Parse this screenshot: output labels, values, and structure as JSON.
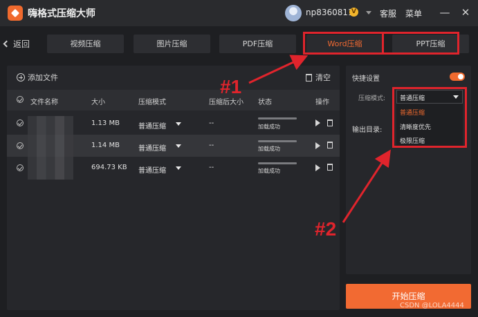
{
  "titlebar": {
    "app_title": "嗨格式压缩大师",
    "username": "np8360811",
    "vip_badge": "V",
    "support_label": "客服",
    "menu_label": "菜单",
    "minimize_glyph": "—",
    "close_glyph": "✕"
  },
  "nav": {
    "back_label": "返回",
    "tabs": [
      {
        "label": "视频压缩"
      },
      {
        "label": "图片压缩"
      },
      {
        "label": "PDF压缩"
      },
      {
        "label": "Word压缩"
      },
      {
        "label": "PPT压缩"
      }
    ],
    "active_tab": "Word压缩"
  },
  "file_panel": {
    "add_file_label": "添加文件",
    "clear_label": "清空",
    "columns": [
      "文件名称",
      "大小",
      "压缩模式",
      "压缩后大小",
      "状态",
      "操作"
    ],
    "rows": [
      {
        "size": "1.13 MB",
        "mode": "普通压缩",
        "compressed_size": "--",
        "status": "加载成功",
        "progress": 1.0
      },
      {
        "size": "1.14 MB",
        "mode": "普通压缩",
        "compressed_size": "--",
        "status": "加载成功",
        "progress": 1.0
      },
      {
        "size": "694.73 KB",
        "mode": "普通压缩",
        "compressed_size": "--",
        "status": "加载成功",
        "progress": 1.0
      }
    ]
  },
  "settings": {
    "quick_settings_label": "快捷设置",
    "quick_settings_on": true,
    "compression_mode_label": "压缩模式:",
    "compression_mode_value": "普通压缩",
    "compression_mode_options": [
      "普通压缩",
      "清晰度优先",
      "极限压缩"
    ],
    "selected_option": "普通压缩",
    "output_dir_label": "输出目录:"
  },
  "actions": {
    "start_label": "开始压缩"
  },
  "annotations": {
    "marker_1": "#1",
    "marker_2": "#2",
    "color": "#e0242c"
  },
  "watermark": "CSDN @LOLA4444",
  "colors": {
    "accent": "#f26a32",
    "background": "#1e1f22",
    "panel": "#26272b"
  }
}
